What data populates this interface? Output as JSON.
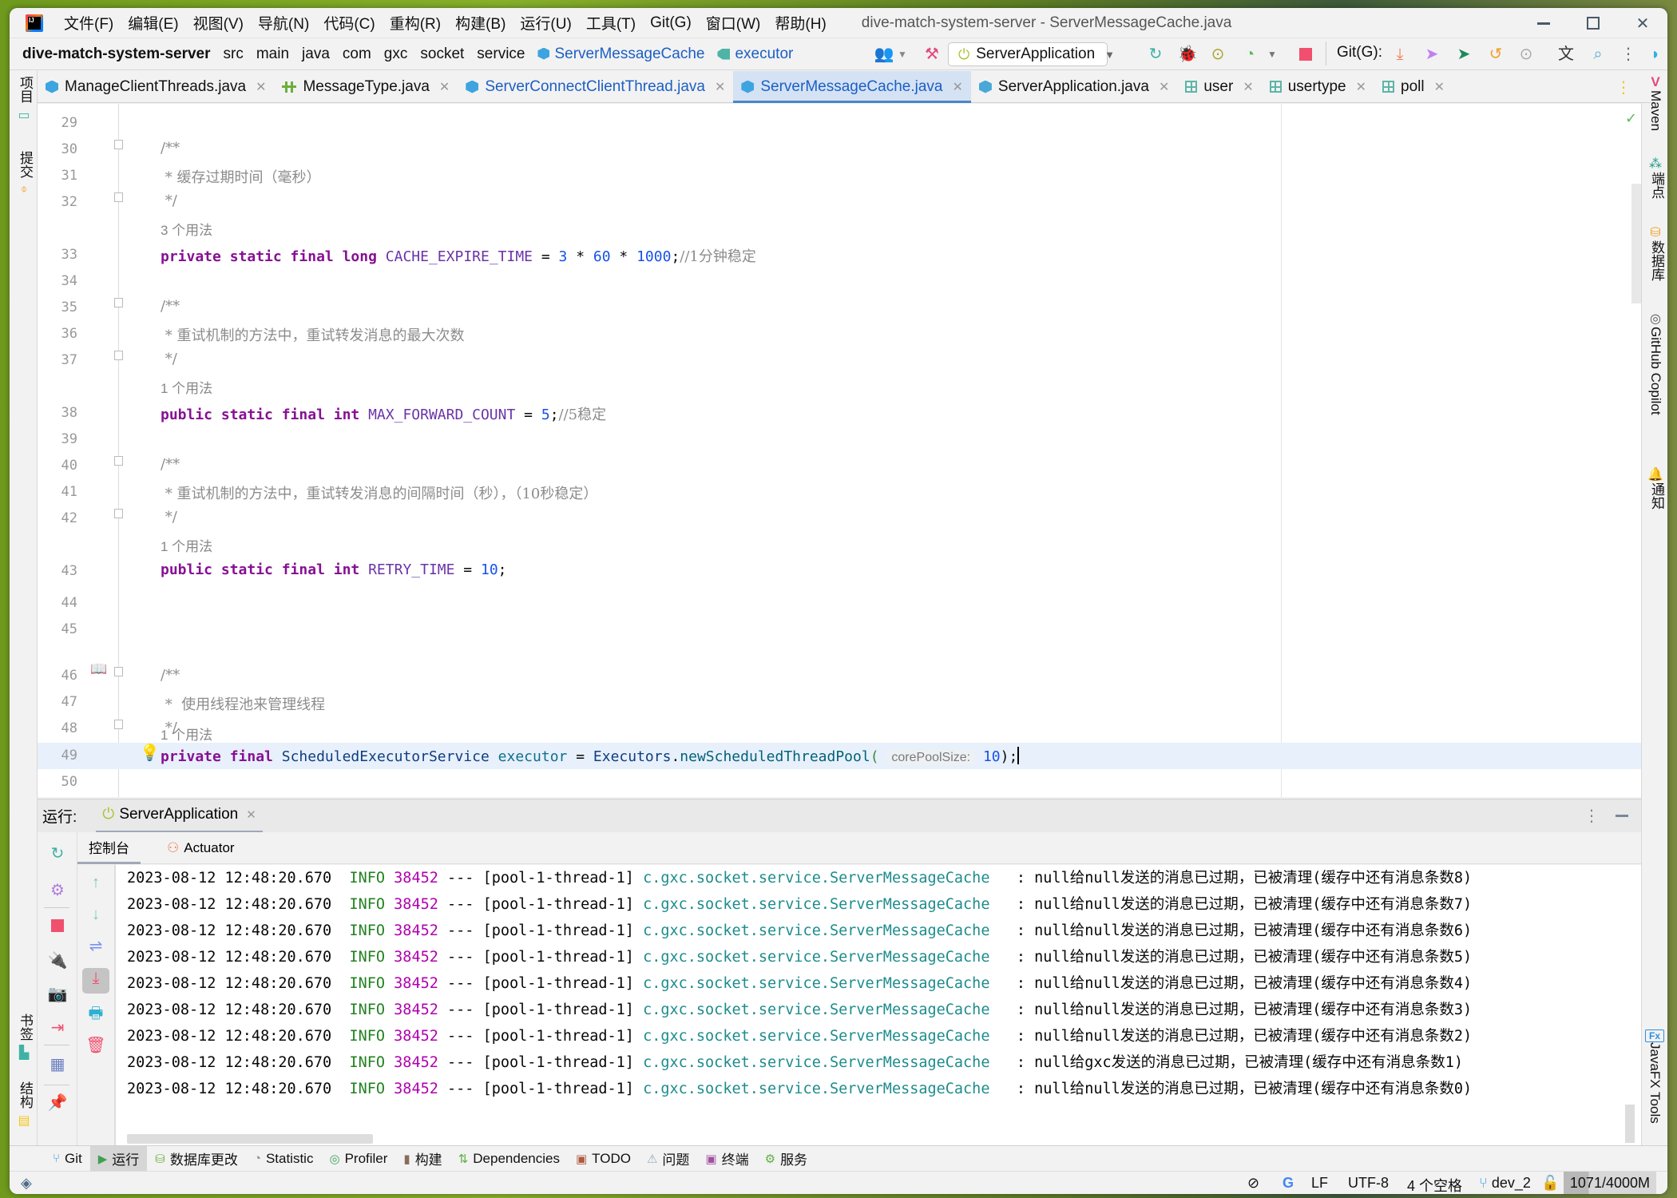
{
  "window": {
    "title": "dive-match-system-server - ServerMessageCache.java",
    "controls": {
      "minimize": "minimize-icon",
      "maximize": "maximize-icon",
      "close": "close-icon"
    }
  },
  "menu": [
    "文件(F)",
    "编辑(E)",
    "视图(V)",
    "导航(N)",
    "代码(C)",
    "重构(R)",
    "构建(B)",
    "运行(U)",
    "工具(T)",
    "Git(G)",
    "窗口(W)",
    "帮助(H)"
  ],
  "breadcrumb": {
    "project": "dive-match-system-server",
    "parts": [
      "src",
      "main",
      "java",
      "com",
      "gxc",
      "socket",
      "service"
    ],
    "class": "ServerMessageCache",
    "field": "executor"
  },
  "toolbar": {
    "run_config": "ServerApplication",
    "git_label": "Git(G):"
  },
  "tabs": [
    {
      "label": "ManageClientThreads.java",
      "icon": "class-icon",
      "active": false
    },
    {
      "label": "MessageType.java",
      "icon": "enum-icon",
      "active": false
    },
    {
      "label": "ServerConnectClientThread.java",
      "icon": "class-icon",
      "active": false
    },
    {
      "label": "ServerMessageCache.java",
      "icon": "class-icon",
      "active": true
    },
    {
      "label": "ServerApplication.java",
      "icon": "spring-boot-class-icon",
      "active": false
    },
    {
      "label": "user",
      "icon": "table-icon",
      "active": false
    },
    {
      "label": "usertype",
      "icon": "table-icon",
      "active": false
    },
    {
      "label": "poll",
      "icon": "table-icon",
      "active": false
    }
  ],
  "left_strip": {
    "project": "项目",
    "commit": "提交",
    "bookmarks": "书签",
    "structure": "结构"
  },
  "right_strip": {
    "maven": "Maven",
    "endpoints": "端点",
    "database": "数据库",
    "copilot": "GitHub Copilot",
    "notifications": "通知",
    "javafx": "JavaFX Tools"
  },
  "editor": {
    "line_numbers": [
      "29",
      "30",
      "31",
      "32",
      "33",
      "34",
      "35",
      "36",
      "37",
      "38",
      "39",
      "40",
      "41",
      "42",
      "43",
      "44",
      "45",
      "46",
      "47",
      "48",
      "49",
      "50"
    ],
    "comment1": {
      "open": "/**",
      "text": " * 缓存过期时间（毫秒）",
      "close": " */"
    },
    "usage1": "3 个用法",
    "line33": {
      "mods": "private static final long",
      "name": "CACHE_EXPIRE_TIME",
      "eq": " = ",
      "v1": "3",
      "op1": " * ",
      "v2": "60",
      "op2": " * ",
      "v3": "1000",
      "semi": ";",
      "cmt": "//1分钟稳定"
    },
    "comment2": {
      "open": "/**",
      "text": " * 重试机制的方法中，重试转发消息的最大次数",
      "close": " */"
    },
    "usage2": "1 个用法",
    "line38": {
      "mods": "public static final int",
      "name": "MAX_FORWARD_COUNT",
      "eq": " = ",
      "v": "5",
      "semi": ";",
      "cmt": "//5稳定"
    },
    "comment3": {
      "open": "/**",
      "text": " * 重试机制的方法中，重试转发消息的间隔时间（秒），（10秒稳定）",
      "close": " */"
    },
    "usage3": "1 个用法",
    "line43": {
      "mods": "public static final int",
      "name": "RETRY_TIME",
      "eq": " = ",
      "v": "10",
      "semi": ";"
    },
    "comment4": {
      "open": "/**",
      "text": " *  使用线程池来管理线程",
      "close": " */"
    },
    "usage4": "1 个用法",
    "line49": {
      "mods": "private final",
      "type": "ScheduledExecutorService",
      "name": "executor",
      "eq": " = ",
      "cls": "Executors",
      "dot": ".",
      "method": "newScheduledThreadPool",
      "paren": "(",
      "hint": "corePoolSize:",
      "v": "10",
      "close": ");"
    }
  },
  "run_panel": {
    "label": "运行:",
    "tab": "ServerApplication",
    "subtabs": [
      "控制台",
      "Actuator"
    ]
  },
  "console": {
    "lines": [
      {
        "ts": "2023-08-12 12:48:20.670",
        "level": "INFO",
        "pid": "38452",
        "sep": "---",
        "thread": "[pool-1-thread-1]",
        "logger": "c.gxc.socket.service.ServerMessageCache",
        "msg": "  : null给null发送的消息已过期，已被清理(缓存中还有消息条数8)"
      },
      {
        "ts": "2023-08-12 12:48:20.670",
        "level": "INFO",
        "pid": "38452",
        "sep": "---",
        "thread": "[pool-1-thread-1]",
        "logger": "c.gxc.socket.service.ServerMessageCache",
        "msg": "  : null给null发送的消息已过期，已被清理(缓存中还有消息条数7)"
      },
      {
        "ts": "2023-08-12 12:48:20.670",
        "level": "INFO",
        "pid": "38452",
        "sep": "---",
        "thread": "[pool-1-thread-1]",
        "logger": "c.gxc.socket.service.ServerMessageCache",
        "msg": "  : null给null发送的消息已过期，已被清理(缓存中还有消息条数6)"
      },
      {
        "ts": "2023-08-12 12:48:20.670",
        "level": "INFO",
        "pid": "38452",
        "sep": "---",
        "thread": "[pool-1-thread-1]",
        "logger": "c.gxc.socket.service.ServerMessageCache",
        "msg": "  : null给null发送的消息已过期，已被清理(缓存中还有消息条数5)"
      },
      {
        "ts": "2023-08-12 12:48:20.670",
        "level": "INFO",
        "pid": "38452",
        "sep": "---",
        "thread": "[pool-1-thread-1]",
        "logger": "c.gxc.socket.service.ServerMessageCache",
        "msg": "  : null给null发送的消息已过期，已被清理(缓存中还有消息条数4)"
      },
      {
        "ts": "2023-08-12 12:48:20.670",
        "level": "INFO",
        "pid": "38452",
        "sep": "---",
        "thread": "[pool-1-thread-1]",
        "logger": "c.gxc.socket.service.ServerMessageCache",
        "msg": "  : null给null发送的消息已过期，已被清理(缓存中还有消息条数3)"
      },
      {
        "ts": "2023-08-12 12:48:20.670",
        "level": "INFO",
        "pid": "38452",
        "sep": "---",
        "thread": "[pool-1-thread-1]",
        "logger": "c.gxc.socket.service.ServerMessageCache",
        "msg": "  : null给null发送的消息已过期，已被清理(缓存中还有消息条数2)"
      },
      {
        "ts": "2023-08-12 12:48:20.670",
        "level": "INFO",
        "pid": "38452",
        "sep": "---",
        "thread": "[pool-1-thread-1]",
        "logger": "c.gxc.socket.service.ServerMessageCache",
        "msg": "  : null给gxc发送的消息已过期，已被清理(缓存中还有消息条数1)"
      },
      {
        "ts": "2023-08-12 12:48:20.670",
        "level": "INFO",
        "pid": "38452",
        "sep": "---",
        "thread": "[pool-1-thread-1]",
        "logger": "c.gxc.socket.service.ServerMessageCache",
        "msg": "  : null给null发送的消息已过期，已被清理(缓存中还有消息条数0)"
      }
    ]
  },
  "tool_windows": [
    "Git",
    "运行",
    "数据库更改",
    "Statistic",
    "Profiler",
    "构建",
    "Dependencies",
    "TODO",
    "问题",
    "终端",
    "服务"
  ],
  "status": {
    "line_sep": "LF",
    "encoding": "UTF-8",
    "indent": "4 个空格",
    "branch": "dev_2",
    "memory": "1071/4000M",
    "memory_used_fraction": 0.27
  },
  "colors": {
    "accent": "#4a86c5",
    "info": "#21821f",
    "pid": "#b000b0",
    "logger": "#1e8c8c",
    "keyword": "#871094",
    "number": "#1750eb"
  }
}
